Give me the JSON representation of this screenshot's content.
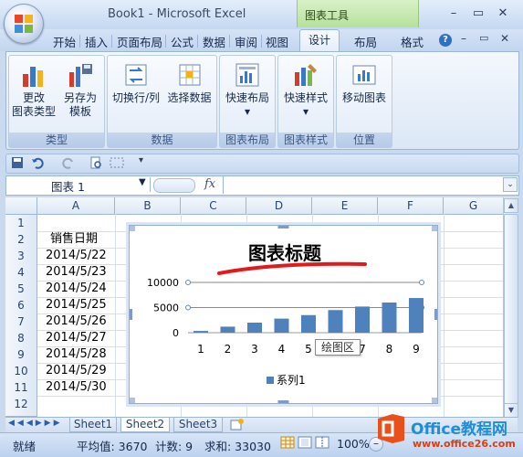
{
  "window": {
    "title": "Book1 - Microsoft Excel",
    "context_tab_group": "图表工具",
    "controls": [
      "–",
      "▭",
      "✕"
    ],
    "inner_controls": [
      "–",
      "▭",
      "✕"
    ]
  },
  "tabs": [
    "开始",
    "插入",
    "页面布局",
    "公式",
    "数据",
    "审阅",
    "视图",
    "设计",
    "布局",
    "格式"
  ],
  "active_tab": "设计",
  "ribbon": {
    "groups": [
      {
        "label": "类型",
        "buttons": [
          {
            "line1": "更改",
            "line2": "图表类型"
          },
          {
            "line1": "另存为",
            "line2": "模板"
          }
        ]
      },
      {
        "label": "数据",
        "buttons": [
          {
            "line1": "切换行/列",
            "line2": ""
          },
          {
            "line1": "选择数据",
            "line2": ""
          }
        ]
      },
      {
        "label": "图表布局",
        "buttons": [
          {
            "line1": "快速布局",
            "line2": "▾"
          }
        ]
      },
      {
        "label": "图表样式",
        "buttons": [
          {
            "line1": "快速样式",
            "line2": "▾"
          }
        ]
      },
      {
        "label": "位置",
        "buttons": [
          {
            "line1": "移动图表",
            "line2": ""
          }
        ]
      }
    ]
  },
  "formula_bar": {
    "name_box": "图表 1",
    "fx": "fx",
    "value": ""
  },
  "columns": [
    "A",
    "B",
    "C",
    "D",
    "E",
    "F",
    "G"
  ],
  "rows": [
    "1",
    "2",
    "3",
    "4",
    "5",
    "6",
    "7",
    "8",
    "9",
    "10",
    "11",
    "12"
  ],
  "cells": {
    "A2": "销售日期",
    "A3": "2014/5/22",
    "A4": "2014/5/23",
    "A5": "2014/5/24",
    "A6": "2014/5/25",
    "A7": "2014/5/26",
    "A8": "2014/5/27",
    "A9": "2014/5/28",
    "A10": "2014/5/29",
    "A11": "2014/5/30"
  },
  "chart_data": {
    "type": "bar",
    "title": "图表标题",
    "categories": [
      "1",
      "2",
      "3",
      "4",
      "5",
      "6",
      "7",
      "8",
      "9"
    ],
    "series": [
      {
        "name": "系列1",
        "values": [
          350,
          1200,
          2000,
          2800,
          3500,
          4500,
          5200,
          6000,
          6900
        ]
      }
    ],
    "y_ticks": [
      "0",
      "5000",
      "10000"
    ],
    "ylim": [
      0,
      10000
    ],
    "legend": "bottom",
    "tooltip": "绘图区",
    "bar_color": "#4f81bd"
  },
  "sheets": [
    "Sheet1",
    "Sheet2",
    "Sheet3"
  ],
  "active_sheet": "Sheet2",
  "status": {
    "ready": "就绪",
    "average": "平均值: 3670",
    "count": "计数: 9",
    "sum": "求和: 33030",
    "zoom": "100%"
  },
  "watermark": {
    "line1": "Office教程网",
    "line2": "www.office26.com"
  }
}
